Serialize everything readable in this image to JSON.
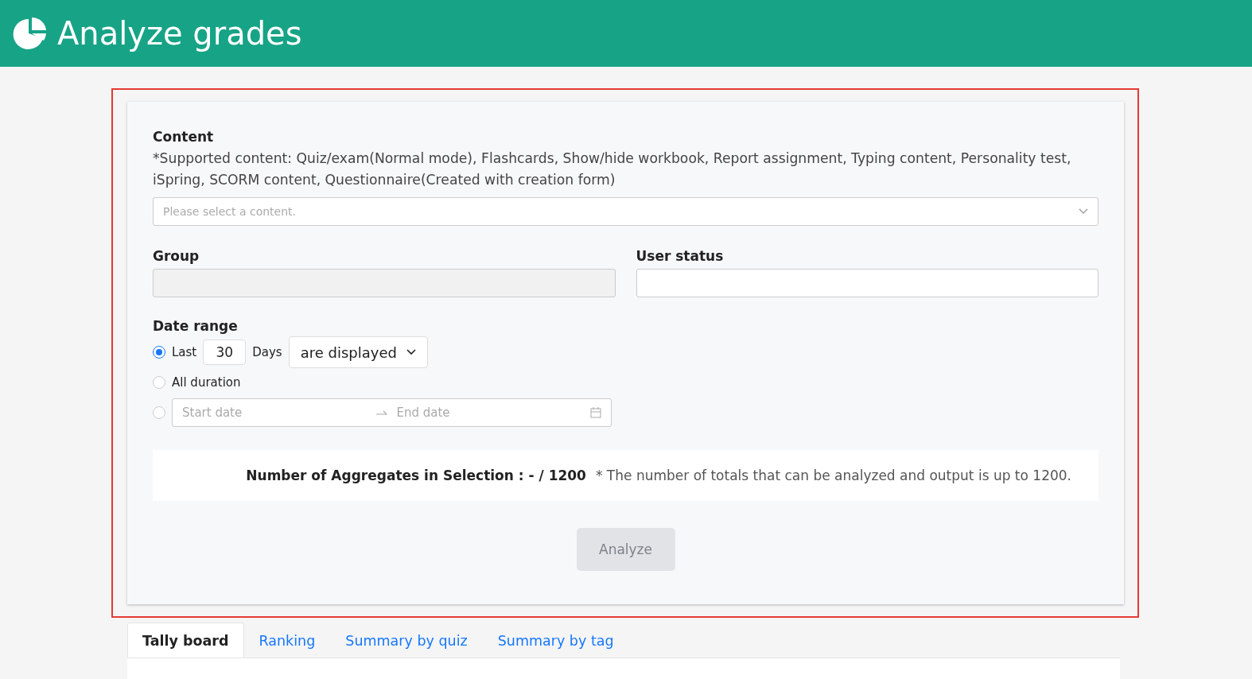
{
  "header": {
    "title": "Analyze grades"
  },
  "form": {
    "highlighted": true,
    "content": {
      "label": "Content",
      "note": "*Supported content: Quiz/exam(Normal mode), Flashcards, Show/hide workbook, Report assignment, Typing content, Personality test, iSpring, SCORM content, Questionnaire(Created with creation form)",
      "placeholder": "Please select a content."
    },
    "group": {
      "label": "Group",
      "disabled": true
    },
    "user_status": {
      "label": "User status",
      "disabled": false
    },
    "date_range": {
      "label": "Date range",
      "options": [
        {
          "kind": "last",
          "selected": true,
          "label": "Last",
          "value": "30",
          "unit": "Days",
          "dropdown": "are displayed"
        },
        {
          "kind": "all",
          "selected": false,
          "label": "All duration"
        },
        {
          "kind": "range",
          "selected": false,
          "start_placeholder": "Start date",
          "end_placeholder": "End date"
        }
      ]
    },
    "aggregates": {
      "label": "Number of Aggregates in Selection : - / 1200",
      "note": "* The number of totals that can be analyzed and output is up to 1200."
    },
    "analyze_button": {
      "label": "Analyze",
      "disabled": true
    }
  },
  "tabs": [
    {
      "label": "Tally board",
      "selected": true
    },
    {
      "label": "Ranking",
      "selected": false
    },
    {
      "label": "Summary by quiz",
      "selected": false
    },
    {
      "label": "Summary by tag",
      "selected": false
    }
  ]
}
